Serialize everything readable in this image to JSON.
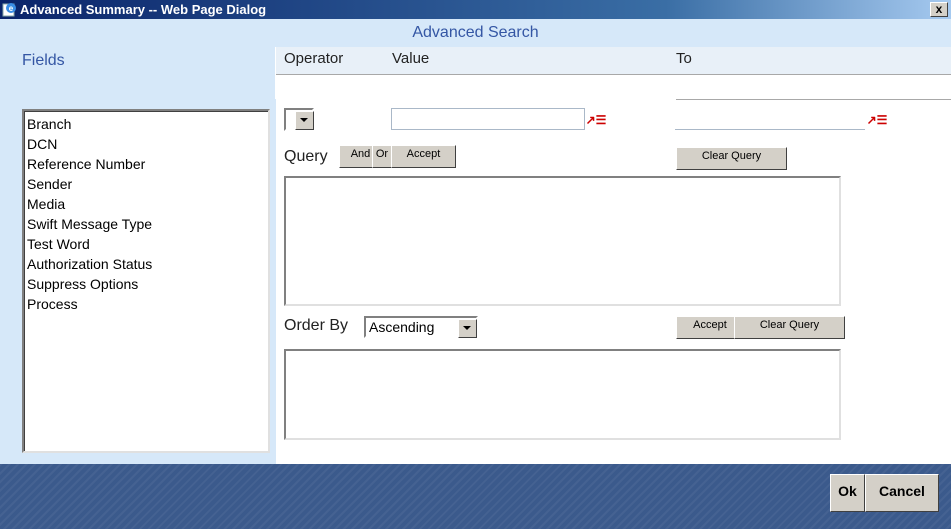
{
  "window": {
    "title": "Advanced Summary -- Web Page Dialog",
    "close_glyph": "x",
    "icon": "ie-page-icon"
  },
  "header": {
    "title": "Advanced Search"
  },
  "columns": {
    "fields": "Fields",
    "operator": "Operator",
    "value": "Value",
    "to": "To"
  },
  "fields_list": [
    "Branch",
    "DCN",
    "Reference Number",
    "Sender",
    "Media",
    "Swift Message Type",
    "Test Word",
    "Authorization Status",
    "Suppress Options",
    "Process"
  ],
  "inputs": {
    "operator_value": "",
    "value": "",
    "to": "",
    "lov_glyph": "↗☰"
  },
  "query": {
    "label": "Query",
    "and_label": "And",
    "or_label": "Or",
    "accept_label": "Accept",
    "clear_label": "Clear Query",
    "text": ""
  },
  "order_by": {
    "label": "Order By",
    "selected": "Ascending",
    "accept_label": "Accept",
    "clear_label": "Clear Query",
    "text": ""
  },
  "footer": {
    "ok_label": "Ok",
    "cancel_label": "Cancel"
  },
  "colors": {
    "title_bar": "#0a246a",
    "header_band": "#d6e8f9",
    "header_text": "#3456a4",
    "footer": "#3b5a8c"
  }
}
